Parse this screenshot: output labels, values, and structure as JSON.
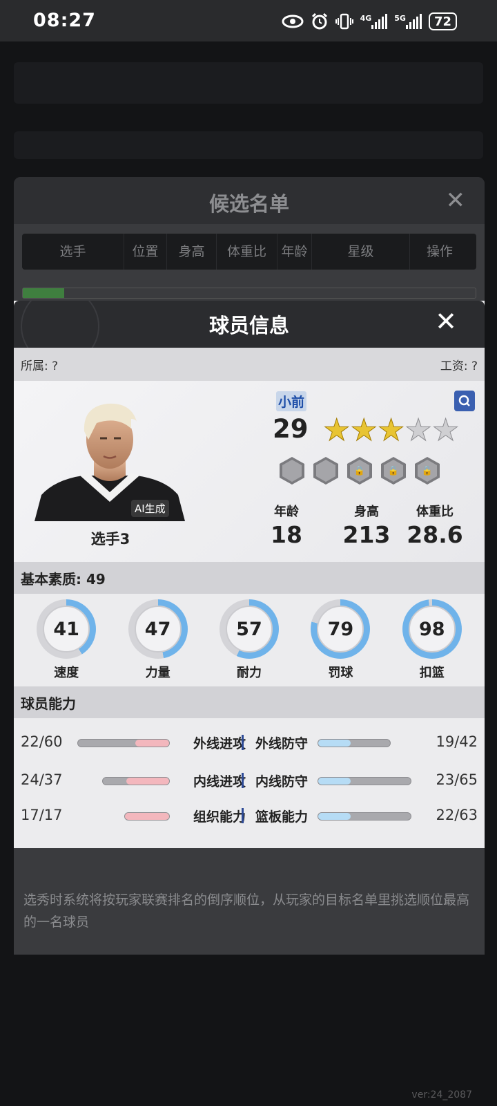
{
  "status": {
    "time": "08:27",
    "battery": "72",
    "net_4g": "4G",
    "net_5g": "5G",
    "icons": [
      "eye-icon",
      "alarm-icon",
      "vibrate-icon",
      "signal-4g-icon",
      "signal-5g-icon",
      "battery-icon"
    ]
  },
  "candidate_list": {
    "title": "候选名单",
    "columns": [
      "选手",
      "位置",
      "身高",
      "体重比",
      "年龄",
      "星级",
      "操作"
    ],
    "note": "选秀时系统将按玩家联赛排名的倒序顺位，从玩家的目标名单里挑选顺位最高的一名球员"
  },
  "player": {
    "modal_title": "球员信息",
    "affiliation": "所属: ?",
    "salary": "工资: ?",
    "ai_tag": "AI生成",
    "name": "选手3",
    "position": "小前",
    "rating": "29",
    "stars_filled": 3,
    "stars_total": 5,
    "bio": [
      {
        "label": "年龄",
        "value": "18"
      },
      {
        "label": "身高",
        "value": "213"
      },
      {
        "label": "体重比",
        "value": "28.6"
      }
    ],
    "basic_quality_label": "基本素质: 49",
    "attributes": [
      {
        "label": "速度",
        "value": "41",
        "fraction": 0.41
      },
      {
        "label": "力量",
        "value": "47",
        "fraction": 0.47
      },
      {
        "label": "耐力",
        "value": "57",
        "fraction": 0.57
      },
      {
        "label": "罚球",
        "value": "79",
        "fraction": 0.79
      },
      {
        "label": "扣篮",
        "value": "98",
        "fraction": 0.98
      }
    ],
    "abilities_label": "球员能力",
    "abilities": [
      {
        "left_value": "22/60",
        "left_name": "外线进攻",
        "left_fill": 0.37,
        "right_name": "外线防守",
        "right_value": "19/42",
        "right_fill": 0.45
      },
      {
        "left_value": "24/37",
        "left_name": "内线进攻",
        "left_fill": 0.65,
        "right_name": "内线防守",
        "right_value": "23/65",
        "right_fill": 0.35
      },
      {
        "left_value": "17/17",
        "left_name": "组织能力",
        "left_fill": 1.0,
        "right_name": "篮板能力",
        "right_value": "22/63",
        "right_fill": 0.35
      }
    ]
  },
  "colors": {
    "ring_blue": "#6fb3ea",
    "ring_track": "#d4d4d8",
    "star_gold": "#e8c433",
    "position_text": "#1e4ea8"
  },
  "version": "ver:24_2087"
}
